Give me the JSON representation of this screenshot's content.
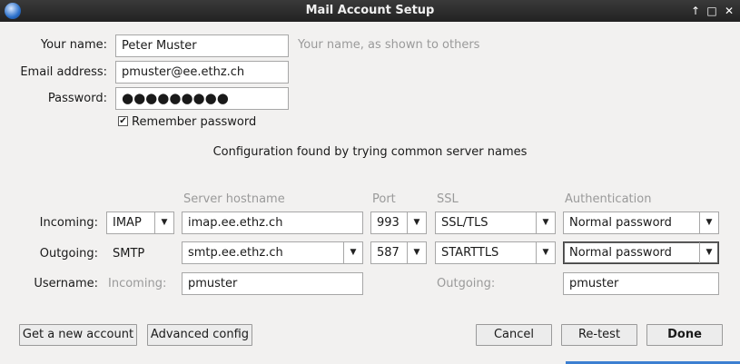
{
  "window": {
    "title": "Mail Account Setup",
    "controls": [
      "↑",
      "□",
      "✕"
    ]
  },
  "identity": {
    "name_label": "Your name:",
    "name_value": "Peter Muster",
    "name_hint": "Your name, as shown to others",
    "email_label": "Email address:",
    "email_value": "pmuster@ee.ethz.ch",
    "password_label": "Password:",
    "password_value": "●●●●●●●●●",
    "remember_label": "Remember password",
    "remember_checked": true,
    "check_glyph": "✔"
  },
  "status_text": "Configuration found by trying common server names",
  "columns": {
    "server": "Server hostname",
    "port": "Port",
    "ssl": "SSL",
    "auth": "Authentication"
  },
  "incoming": {
    "label": "Incoming:",
    "protocol": "IMAP",
    "hostname": "imap.ee.ethz.ch",
    "port": "993",
    "ssl": "SSL/TLS",
    "auth": "Normal password"
  },
  "outgoing": {
    "label": "Outgoing:",
    "protocol": "SMTP",
    "hostname": "smtp.ee.ethz.ch",
    "port": "587",
    "ssl": "STARTTLS",
    "auth": "Normal password"
  },
  "username": {
    "label": "Username:",
    "incoming_label": "Incoming:",
    "incoming_value": "pmuster",
    "outgoing_label": "Outgoing:",
    "outgoing_value": "pmuster"
  },
  "buttons": {
    "new_account": "Get a new account",
    "advanced": "Advanced config",
    "cancel": "Cancel",
    "retest": "Re-test",
    "done": "Done"
  },
  "arrow_glyph": "▼",
  "colors": {
    "accent": "#3c7fd1",
    "titlebar": "#2b2b2b"
  }
}
